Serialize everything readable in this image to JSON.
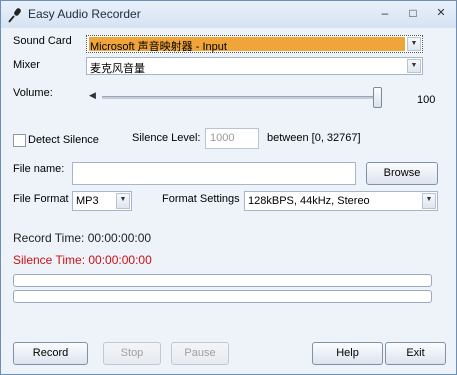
{
  "window": {
    "title": "Easy Audio Recorder"
  },
  "titlebar": {
    "minimize": "–",
    "maximize": "□",
    "close": "✕"
  },
  "sound_card": {
    "label": "Sound Card",
    "value": "Microsoft 声音映射器 - Input"
  },
  "mixer": {
    "label": "Mixer",
    "value": "麦克风音量"
  },
  "volume": {
    "label": "Volume:",
    "value": "100",
    "level": 1.0
  },
  "detect_silence": {
    "label": "Detect Silence",
    "checked": false
  },
  "silence_level": {
    "label": "Silence Level:",
    "value": "1000",
    "range": "between [0, 32767]"
  },
  "file_name": {
    "label": "File name:",
    "value": "",
    "browse_label": "Browse"
  },
  "file_format": {
    "label": "File Format",
    "value": "MP3"
  },
  "format_settings": {
    "label": "Format Settings",
    "value": "128kBPS, 44kHz, Stereo"
  },
  "status": {
    "record_time": "Record Time: 00:00:00:00",
    "silence_time": "Silence Time: 00:00:00:00"
  },
  "level_meters": {
    "left": 0,
    "right": 0
  },
  "buttons": {
    "record": "Record",
    "stop": "Stop",
    "pause": "Pause",
    "help": "Help",
    "exit": "Exit"
  },
  "colors": {
    "selection": "#f0a53a",
    "silence_time": "#cc1111",
    "title_bar": "#dce7f4"
  }
}
